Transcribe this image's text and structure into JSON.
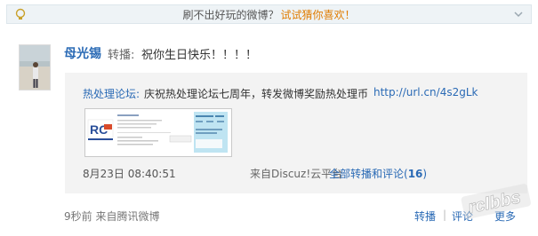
{
  "tip": {
    "text": "刷不出好玩的微博？",
    "link": "试试猜你喜欢！"
  },
  "post": {
    "author": "母光锡",
    "verb": "转播:",
    "content": "祝你生日快乐！！！！",
    "quoted": {
      "author": "热处理论坛:",
      "text": "庆祝热处理论坛七周年，转发微博奖励热处理币",
      "url": "http://url.cn/4s2gLk",
      "time": "8月23日  08:40:51",
      "source": "来自Discuz!云平台",
      "all_reposts_prefix": "全部转播和评论(",
      "all_reposts_count": "16",
      "all_reposts_suffix": ")",
      "thumbnail_logo": "RC"
    },
    "ago": "9秒前  来自腾讯微博"
  },
  "actions": {
    "repost": "转播",
    "separator": "|",
    "comment": "评论",
    "more": "更多"
  },
  "watermark": "rclbbs",
  "colors": {
    "link": "#2a6ab5",
    "tip_link": "#e07c00",
    "tip_bg": "#eef3f6",
    "quote_bg": "#f3f3f3"
  }
}
